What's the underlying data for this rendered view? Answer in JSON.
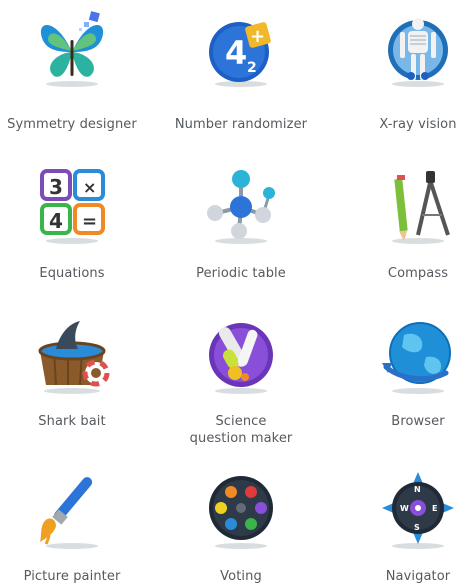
{
  "apps": [
    {
      "label": "Symmetry designer",
      "icon": "butterfly-icon"
    },
    {
      "label": "Number randomizer",
      "icon": "number-dice-icon"
    },
    {
      "label": "X-ray vision",
      "icon": "skeleton-icon"
    },
    {
      "label": "Equations",
      "icon": "equation-tiles-icon"
    },
    {
      "label": "Periodic table",
      "icon": "molecule-icon"
    },
    {
      "label": "Compass",
      "icon": "drawing-compass-icon"
    },
    {
      "label": "Shark bait",
      "icon": "shark-tub-icon"
    },
    {
      "label": "Science question maker",
      "label_line1": "Science",
      "label_line2": "question maker",
      "icon": "test-tube-icon"
    },
    {
      "label": "Browser",
      "icon": "globe-icon"
    },
    {
      "label": "Picture painter",
      "icon": "paintbrush-icon"
    },
    {
      "label": "Voting",
      "icon": "voting-palette-icon"
    },
    {
      "label": "Navigator",
      "icon": "nav-compass-icon"
    }
  ],
  "colors": {
    "label": "#555a5f",
    "background": "#ffffff"
  }
}
